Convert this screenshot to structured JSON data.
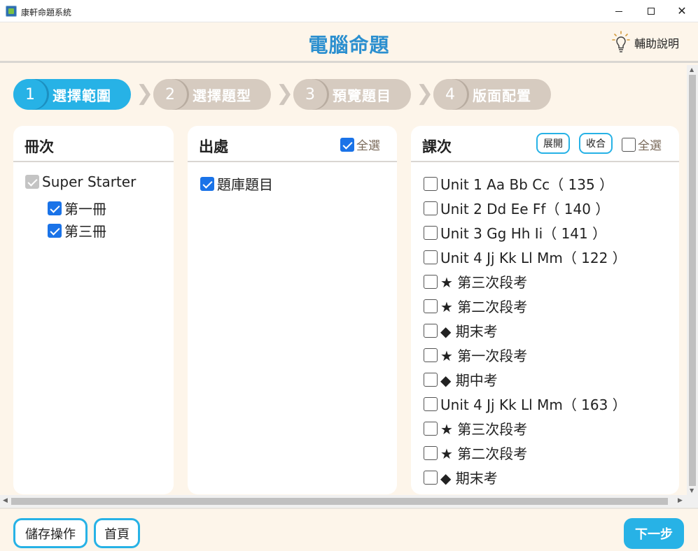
{
  "window": {
    "title": "康軒命題系統",
    "minimize_icon": "minimize-icon",
    "maximize_icon": "maximize-icon",
    "close_icon": "close-icon"
  },
  "header": {
    "title": "電腦命題",
    "help_label": "輔助說明",
    "help_icon": "lightbulb-icon"
  },
  "steps": [
    {
      "num": "1",
      "label": "選擇範圍",
      "active": true
    },
    {
      "num": "2",
      "label": "選擇題型",
      "active": false
    },
    {
      "num": "3",
      "label": "預覽題目",
      "active": false
    },
    {
      "num": "4",
      "label": "版面配置",
      "active": false
    }
  ],
  "volumes_panel": {
    "title": "冊次",
    "root": {
      "label": "Super Starter",
      "checked": true,
      "disabled": true
    },
    "items": [
      {
        "label": "第一冊",
        "checked": true
      },
      {
        "label": "第三冊",
        "checked": true
      }
    ]
  },
  "source_panel": {
    "title": "出處",
    "select_all_label": "全選",
    "select_all_checked": true,
    "items": [
      {
        "label": "題庫題目",
        "checked": true
      }
    ]
  },
  "lessons_panel": {
    "title": "課次",
    "expand_label": "展開",
    "collapse_label": "收合",
    "select_all_label": "全選",
    "select_all_checked": false,
    "items": [
      {
        "label": "Unit 1 Aa Bb Cc（ 135 ）",
        "checked": false
      },
      {
        "label": "Unit 2 Dd Ee Ff（ 140 ）",
        "checked": false
      },
      {
        "label": "Unit 3 Gg Hh Ii（ 141 ）",
        "checked": false
      },
      {
        "label": "Unit 4 Jj Kk Ll Mm（ 122 ）",
        "checked": false
      },
      {
        "label": "★ 第三次段考",
        "checked": false
      },
      {
        "label": "★ 第二次段考",
        "checked": false
      },
      {
        "label": "◆ 期末考",
        "checked": false
      },
      {
        "label": "★ 第一次段考",
        "checked": false
      },
      {
        "label": "◆ 期中考",
        "checked": false
      },
      {
        "label": "Unit 4 Jj Kk Ll Mm（ 163 ）",
        "checked": false
      },
      {
        "label": "★ 第三次段考",
        "checked": false
      },
      {
        "label": "★ 第二次段考",
        "checked": false
      },
      {
        "label": "◆ 期末考",
        "checked": false
      }
    ]
  },
  "footer": {
    "save_label": "儲存操作",
    "home_label": "首頁",
    "next_label": "下一步"
  },
  "colors": {
    "accent": "#27b2e6",
    "title_blue": "#2b8fcf",
    "inactive_step": "#d6cbc0",
    "background": "#fdf5ea"
  }
}
